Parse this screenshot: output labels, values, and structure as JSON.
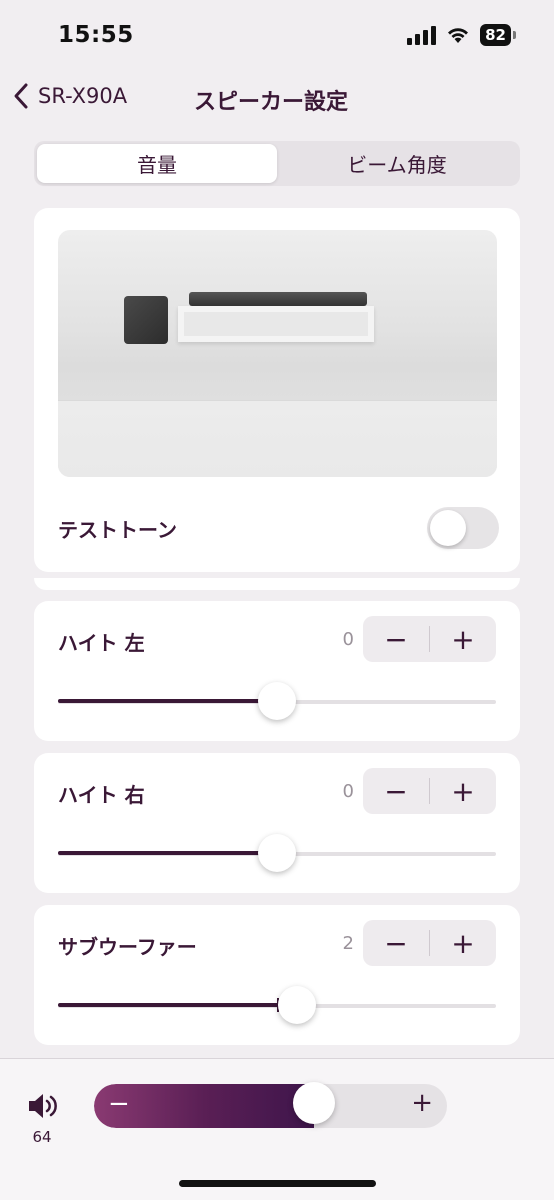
{
  "status_bar": {
    "time": "15:55",
    "battery": "82"
  },
  "nav": {
    "back_label": "SR-X90A",
    "title": "スピーカー設定"
  },
  "tabs": [
    {
      "label": "音量",
      "active": true
    },
    {
      "label": "ビーム角度",
      "active": false
    }
  ],
  "test_tone": {
    "label": "テストトーン",
    "enabled": false
  },
  "levels": [
    {
      "name": "ハイト 左",
      "value": "0",
      "slider_fraction": 0.5
    },
    {
      "name": "ハイト 右",
      "value": "0",
      "slider_fraction": 0.5
    },
    {
      "name": "サブウーファー",
      "value": "2",
      "slider_fraction": 0.545
    }
  ],
  "stepper": {
    "minus": "−",
    "plus": "+"
  },
  "volume": {
    "value": "64",
    "fraction": 0.64,
    "minus": "−",
    "plus": "+"
  },
  "colors": {
    "accent": "#3a1836",
    "background": "#f1eef1",
    "card": "#ffffff"
  }
}
